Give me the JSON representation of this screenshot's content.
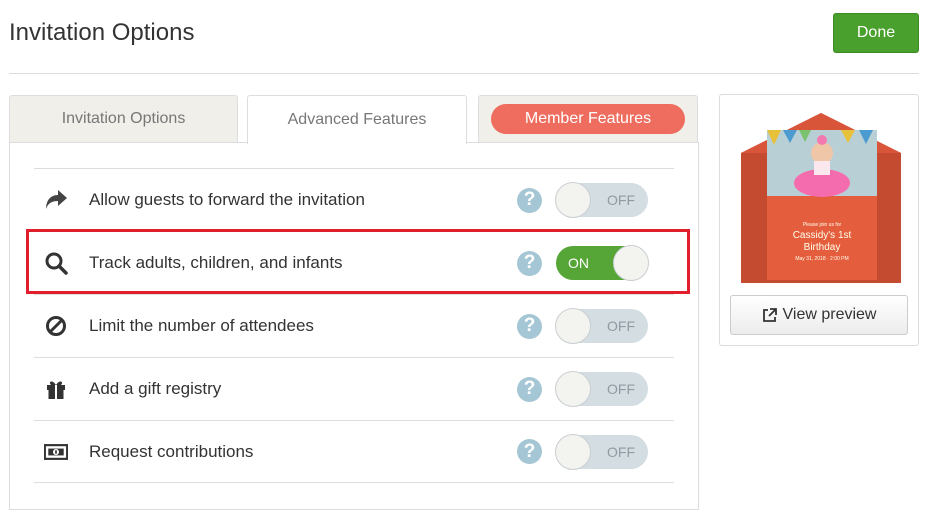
{
  "header": {
    "title": "Invitation Options",
    "done_label": "Done"
  },
  "tabs": [
    {
      "label": "Invitation Options",
      "active": false
    },
    {
      "label": "Advanced Features",
      "active": true
    },
    {
      "label": "Member Features",
      "active": false
    }
  ],
  "features": [
    {
      "icon": "share-arrow-icon",
      "label": "Allow guests to forward the invitation",
      "state": "OFF"
    },
    {
      "icon": "magnifier-icon",
      "label": "Track adults, children, and infants",
      "state": "ON"
    },
    {
      "icon": "prohibited-icon",
      "label": "Limit the number of attendees",
      "state": "OFF"
    },
    {
      "icon": "gift-icon",
      "label": "Add a gift registry",
      "state": "OFF"
    },
    {
      "icon": "money-bill-icon",
      "label": "Request contributions",
      "state": "OFF"
    }
  ],
  "help_symbol": "?",
  "preview": {
    "card_small_text": "Please join us for",
    "card_title_line1": "Cassidy's 1st",
    "card_title_line2": "Birthday",
    "card_date": "May 31, 2018 · 2:00 PM",
    "view_label": "View preview"
  },
  "colors": {
    "done_green": "#4aa02c",
    "member_pill": "#ef6d5e",
    "toggle_on": "#55a637",
    "help_blue": "#a5c6d4",
    "highlight_red": "#e11e2b",
    "envelope_orange": "#d9553a"
  }
}
